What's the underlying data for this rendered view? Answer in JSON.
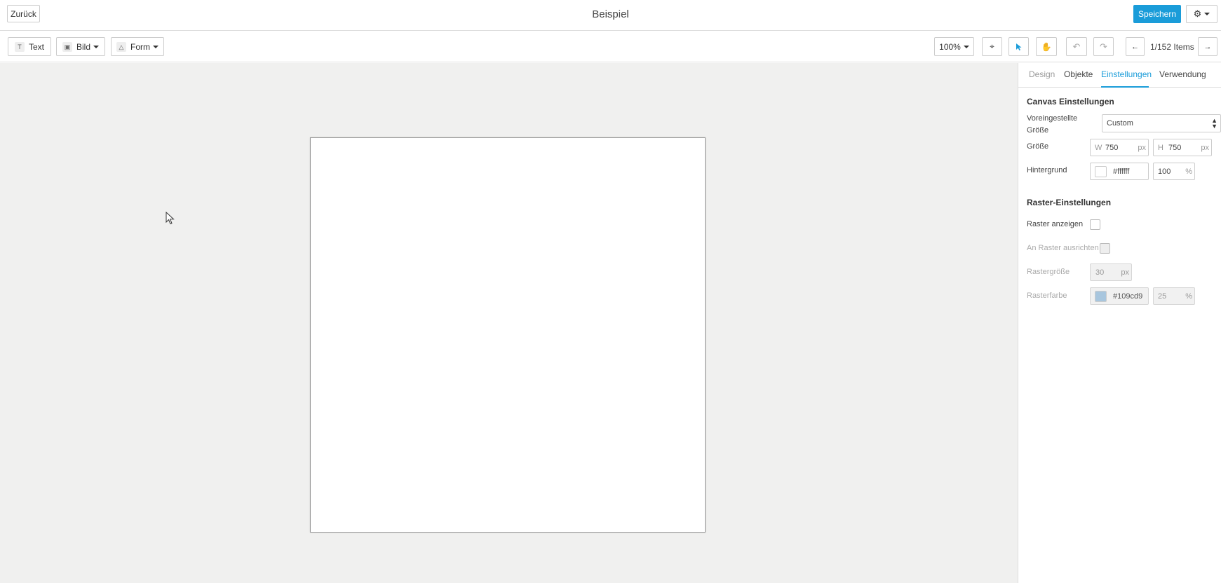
{
  "header": {
    "back_label": "Zurück",
    "title": "Beispiel",
    "save_label": "Speichern"
  },
  "toolbar": {
    "text_label": "Text",
    "image_label": "Bild",
    "shape_label": "Form",
    "zoom_label": "100%",
    "items_label": "1/152 Items"
  },
  "panel": {
    "tabs": [
      {
        "label": "Design",
        "state": "inactive"
      },
      {
        "label": "Objekte",
        "state": "normal"
      },
      {
        "label": "Einstellungen",
        "state": "active"
      },
      {
        "label": "Verwendung",
        "state": "normal"
      }
    ],
    "canvas_section_title": "Canvas Einstellungen",
    "preset_size_label": "Voreingestellte Größe",
    "preset_size_value": "Custom",
    "size_label": "Größe",
    "width_prefix": "W",
    "width_value": "750",
    "height_prefix": "H",
    "height_value": "750",
    "unit_px": "px",
    "background_label": "Hintergrund",
    "background_color": "#ffffff",
    "background_opacity": "100",
    "unit_percent": "%",
    "grid_section_title": "Raster-Einstellungen",
    "show_grid_label": "Raster anzeigen",
    "snap_grid_label": "An Raster ausrichten",
    "grid_size_label": "Rastergröße",
    "grid_size_value": "30",
    "grid_color_label": "Rasterfarbe",
    "grid_color_value": "#109cd9",
    "grid_opacity_value": "25"
  },
  "colors": {
    "accent": "#1a9cd9",
    "canvas_bg": "#f0f0ef"
  }
}
